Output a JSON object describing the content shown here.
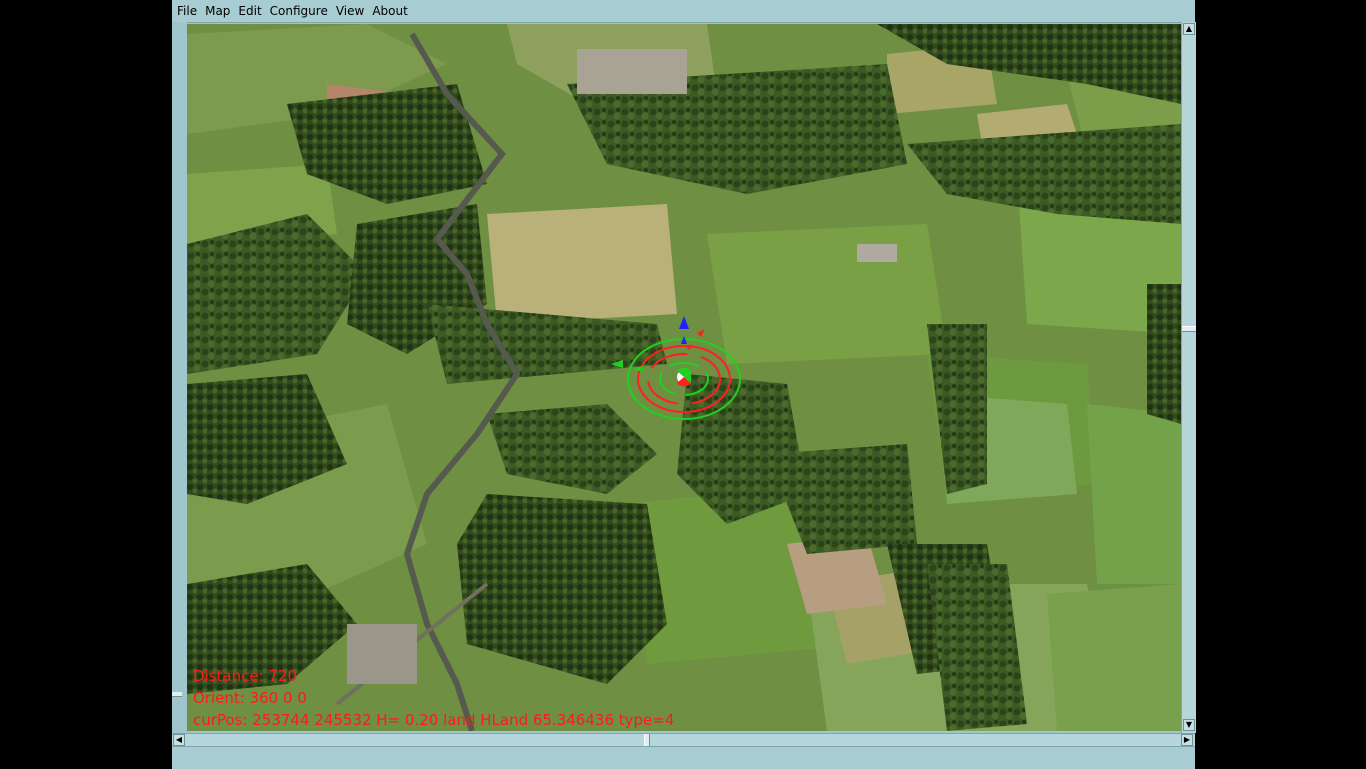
{
  "menubar": {
    "items": [
      "File",
      "Map",
      "Edit",
      "Configure",
      "View",
      "About"
    ]
  },
  "viewport": {
    "hud": {
      "distance": "Distance: 720",
      "orient": "Orient: 360 0 0",
      "curpos": "curPos: 253744 245532 H= 0.20 land HLand 65.346436 type=4"
    },
    "hud_color": "#ff1a1a",
    "gizmo_colors": {
      "x": "#ff2020",
      "y": "#20d020",
      "z": "#2020ff"
    }
  },
  "scrollbars": {
    "up_icon": "arrow-up-icon",
    "down_icon": "arrow-down-icon",
    "left_icon": "arrow-left-icon",
    "right_icon": "arrow-right-icon"
  }
}
